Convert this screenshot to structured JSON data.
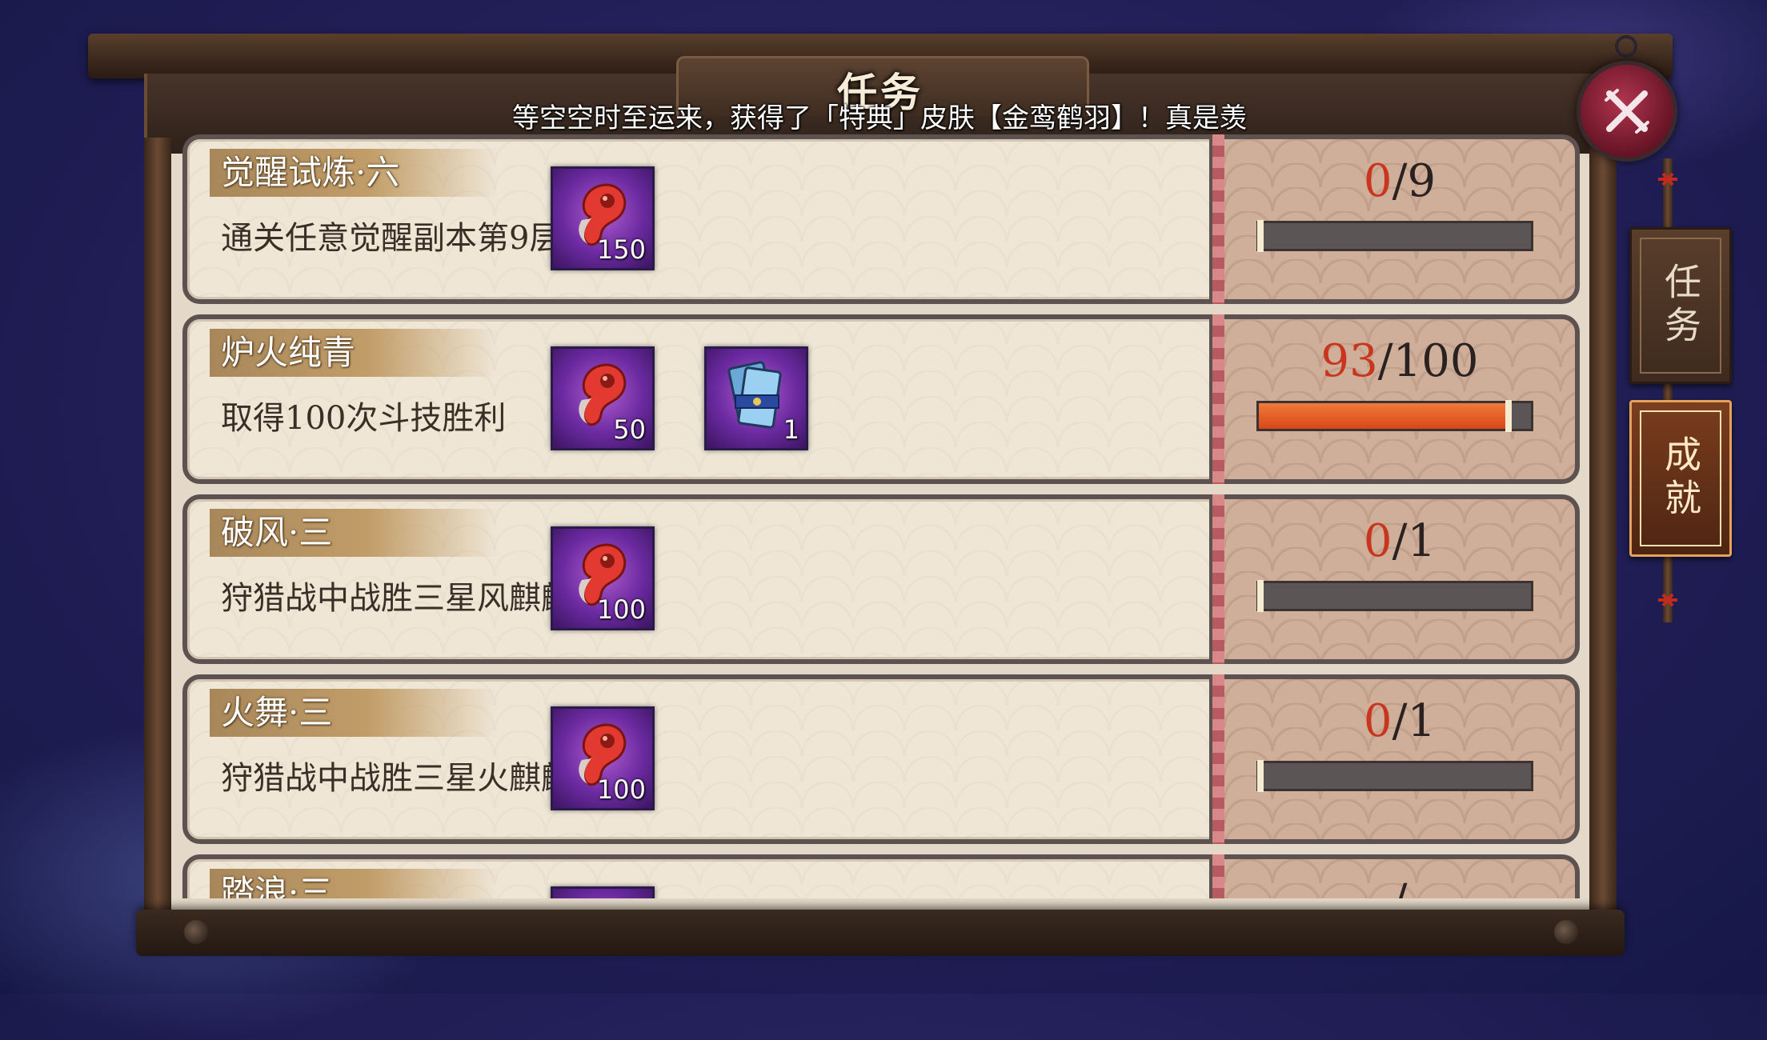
{
  "header": {
    "title": "任务"
  },
  "marquee": {
    "text": "等空空时至运来，获得了「特典」皮肤【金鸾鹤羽】！真是羡"
  },
  "side_tabs": [
    {
      "label": "任务",
      "active": false
    },
    {
      "label": "成就",
      "active": true
    }
  ],
  "tasks": [
    {
      "name": "觉醒试炼·六",
      "desc": "通关任意觉醒副本第9层",
      "rewards": [
        {
          "icon": "red-magatama-icon",
          "count": "150"
        }
      ],
      "progress": {
        "current": "0",
        "total": "9",
        "fraction": 0
      }
    },
    {
      "name": "炉火纯青",
      "desc": "取得100次斗技胜利",
      "rewards": [
        {
          "icon": "red-magatama-icon",
          "count": "50"
        },
        {
          "icon": "blue-ticket-icon",
          "count": "1"
        }
      ],
      "progress": {
        "current": "93",
        "total": "100",
        "fraction": 0.93
      }
    },
    {
      "name": "破风·三",
      "desc": "狩猎战中战胜三星风麒麟",
      "rewards": [
        {
          "icon": "red-magatama-icon",
          "count": "100"
        }
      ],
      "progress": {
        "current": "0",
        "total": "1",
        "fraction": 0
      }
    },
    {
      "name": "火舞·三",
      "desc": "狩猎战中战胜三星火麒麟",
      "rewards": [
        {
          "icon": "red-magatama-icon",
          "count": "100"
        }
      ],
      "progress": {
        "current": "0",
        "total": "1",
        "fraction": 0
      }
    },
    {
      "name": "踏浪·三",
      "desc": "",
      "rewards": [
        {
          "icon": "red-magatama-icon",
          "count": ""
        }
      ],
      "progress": {
        "current": "",
        "total": "",
        "fraction": 0
      }
    }
  ],
  "colors": {
    "progress_current": "#c8361d",
    "progress_fill": "#e0541e",
    "accent_tab": "#e6a15b"
  }
}
